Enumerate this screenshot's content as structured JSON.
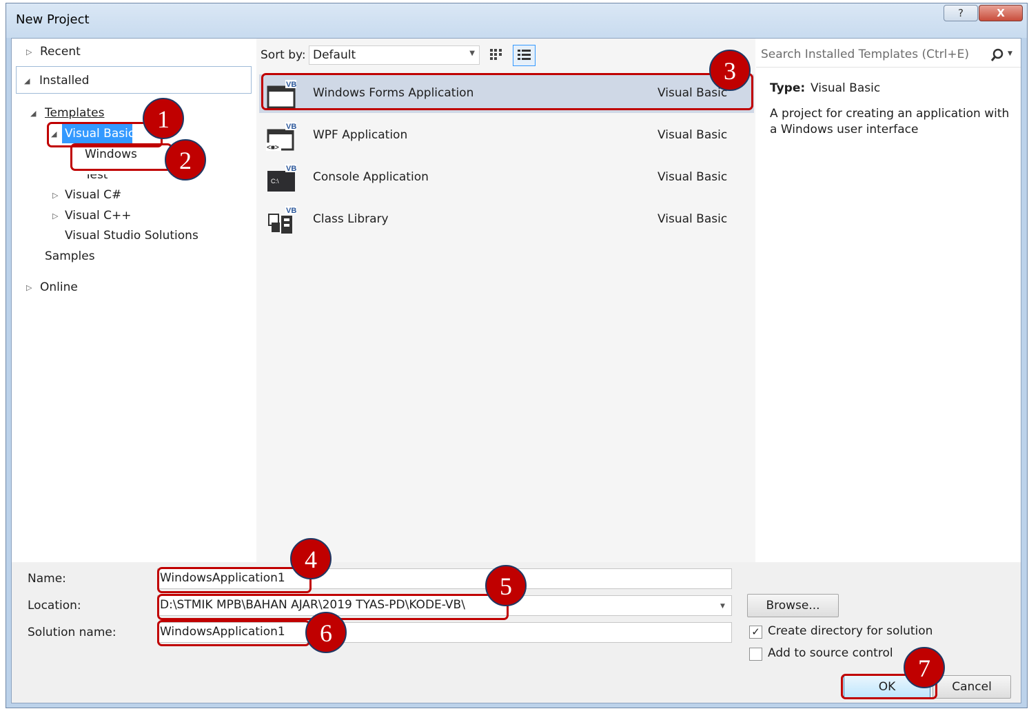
{
  "window": {
    "title": "New Project",
    "help_label": "?",
    "close_label": "X"
  },
  "tree": {
    "recent": "Recent",
    "installed": "Installed",
    "templates": "Templates",
    "visual_basic": "Visual Basic",
    "windows": "Windows",
    "test": "Test",
    "visual_csharp": "Visual C#",
    "visual_cpp": "Visual C++",
    "vs_solutions": "Visual Studio Solutions",
    "samples": "Samples",
    "online": "Online"
  },
  "sortbar": {
    "label": "Sort by:",
    "value": "Default"
  },
  "search": {
    "placeholder": "Search Installed Templates (Ctrl+E)"
  },
  "templates": [
    {
      "name": "Windows Forms Application",
      "lang": "Visual Basic",
      "icon": "vb-windows-forms-icon",
      "selected": true
    },
    {
      "name": "WPF Application",
      "lang": "Visual Basic",
      "icon": "vb-wpf-icon"
    },
    {
      "name": "Console Application",
      "lang": "Visual Basic",
      "icon": "vb-console-icon"
    },
    {
      "name": "Class Library",
      "lang": "Visual Basic",
      "icon": "vb-class-library-icon"
    }
  ],
  "details": {
    "type_label": "Type:",
    "type_value": "Visual Basic",
    "description": "A project for creating an application with a Windows user interface"
  },
  "form": {
    "name_label": "Name:",
    "name_value": "WindowsApplication1",
    "location_label": "Location:",
    "location_value": "D:\\STMIK MPB\\BAHAN AJAR\\2019 TYAS-PD\\KODE-VB\\",
    "solution_label": "Solution name:",
    "solution_value": "WindowsApplication1",
    "browse_label": "Browse...",
    "create_dir_label": "Create directory for solution",
    "create_dir_checked": true,
    "source_control_label": "Add to source control",
    "source_control_checked": false,
    "ok_label": "OK",
    "cancel_label": "Cancel"
  },
  "annotations": [
    "1",
    "2",
    "3",
    "4",
    "5",
    "6",
    "7"
  ],
  "colors": {
    "annotation": "#c00000",
    "selection": "#3399ff"
  }
}
